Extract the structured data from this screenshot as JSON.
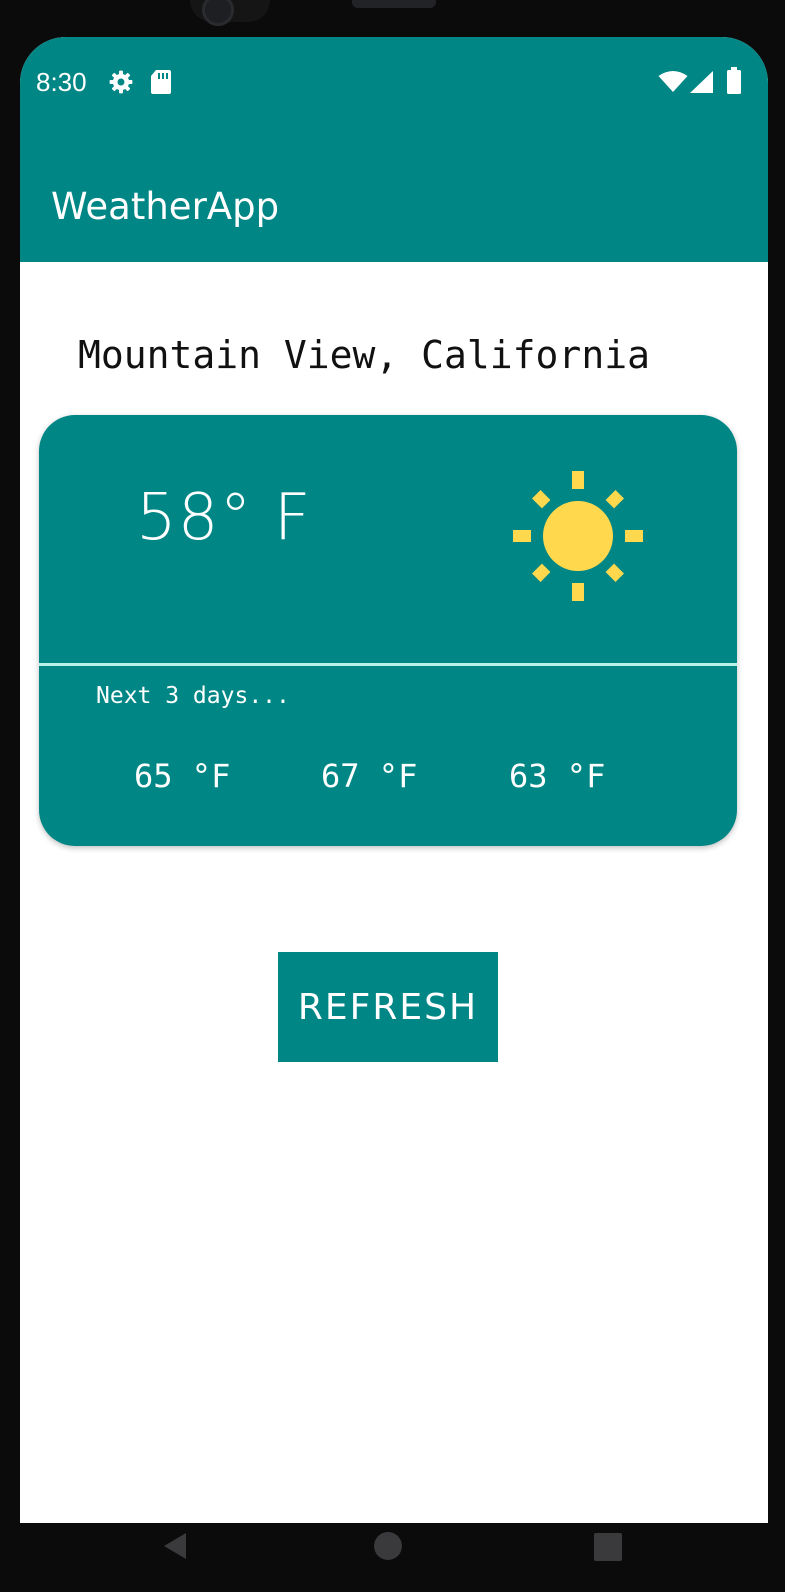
{
  "status_bar": {
    "time": "8:30",
    "left_icons": [
      "gear-icon",
      "sd-card-icon"
    ],
    "right_icons": [
      "wifi-icon",
      "cellular-signal-icon",
      "battery-icon"
    ]
  },
  "app": {
    "title": "WeatherApp",
    "primary_color": "#008785",
    "divider_color": "#b9f2e6",
    "sun_color": "#ffd84d"
  },
  "location": {
    "name": "Mountain View, California"
  },
  "current": {
    "temperature": "58° F",
    "condition_icon": "sun-icon"
  },
  "forecast": {
    "label": "Next 3 days...",
    "days": [
      {
        "temperature": "65 °F"
      },
      {
        "temperature": "67 °F"
      },
      {
        "temperature": "63 °F"
      }
    ]
  },
  "actions": {
    "refresh_label": "REFRESH"
  },
  "nav_bar": {
    "buttons": [
      "back-icon",
      "home-icon",
      "recents-icon"
    ]
  }
}
